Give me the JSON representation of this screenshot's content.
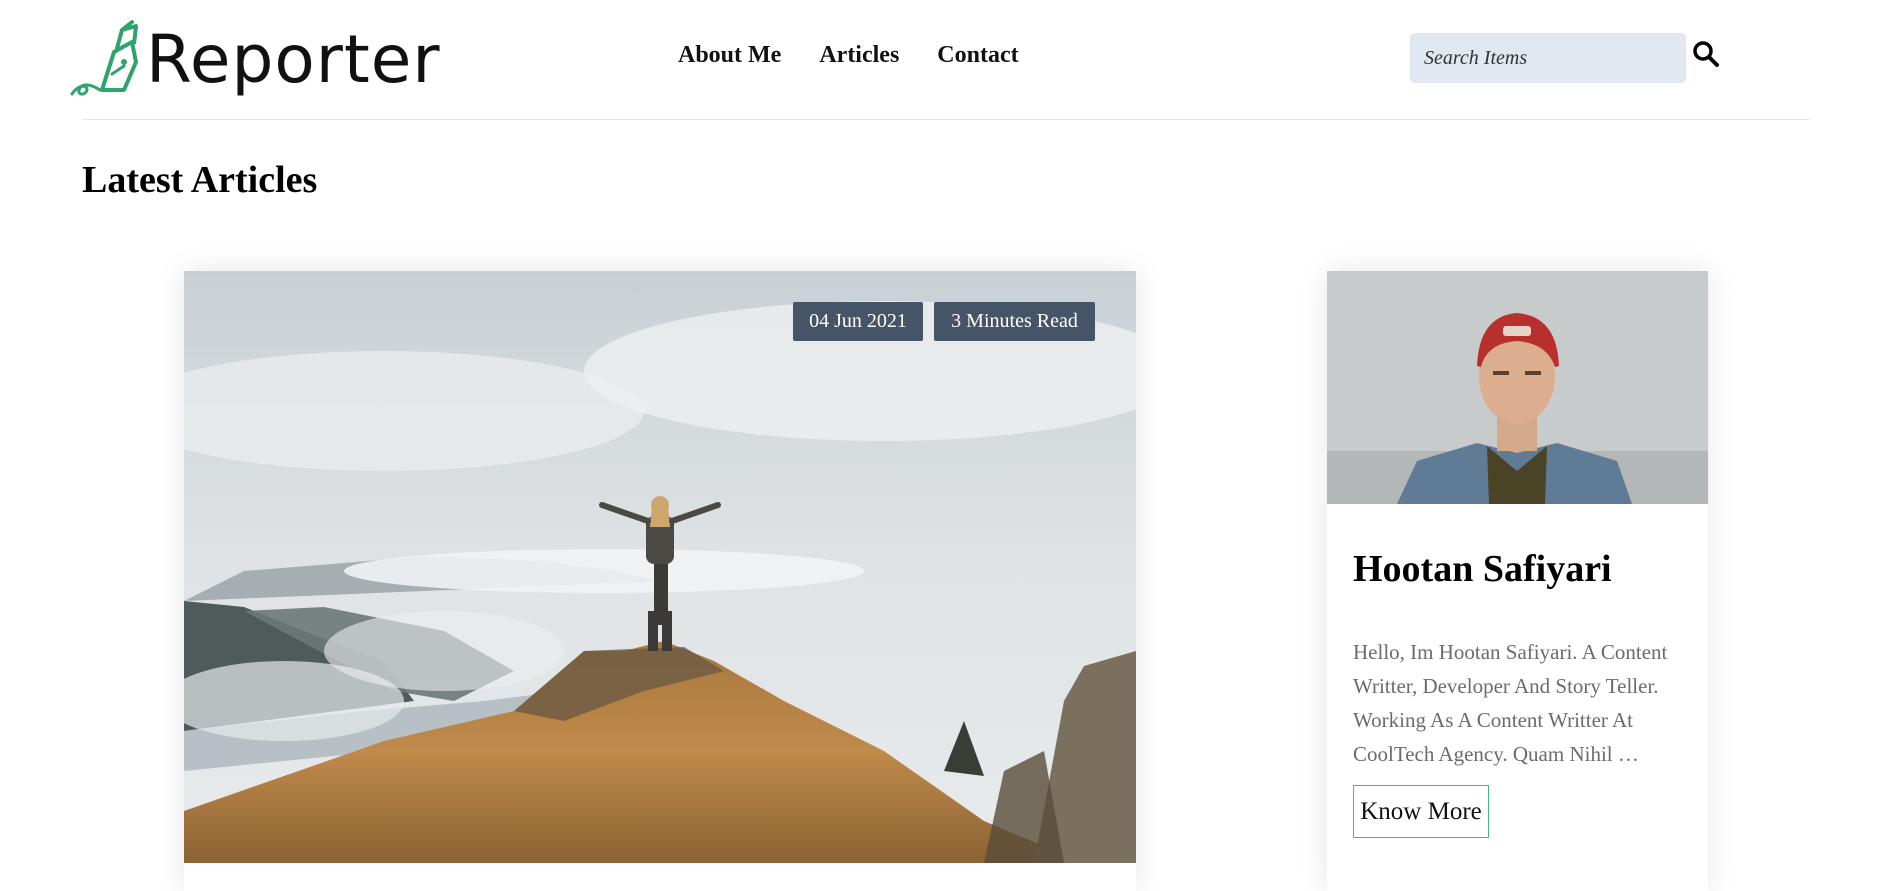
{
  "brand": {
    "name": "Reporter",
    "icon": "pen-nib-logo-icon",
    "accent": "#2fa36b"
  },
  "nav": {
    "items": [
      "About Me",
      "Articles",
      "Contact"
    ]
  },
  "search": {
    "placeholder": "Search Items",
    "value": "",
    "icon": "search-icon"
  },
  "section": {
    "title": "Latest Articles"
  },
  "article": {
    "date": "04 Jun 2021",
    "read_time": "3 Minutes Read",
    "image": "woman-on-mountain-summit-photo",
    "badge_color": "#465468"
  },
  "author": {
    "name": "Hootan Safiyari",
    "bio": "Hello, Im Hootan Safiyari. A Content Writter, Developer And Story Teller. Working As A Content Writter At CoolTech Agency. Quam Nihil …",
    "button": "Know More",
    "photo": "man-in-red-cap-portrait",
    "button_border_color": "#3fbf7a"
  },
  "colors": {
    "search_bg": "#e1e8f1",
    "bio_text": "#6b6b6b"
  }
}
